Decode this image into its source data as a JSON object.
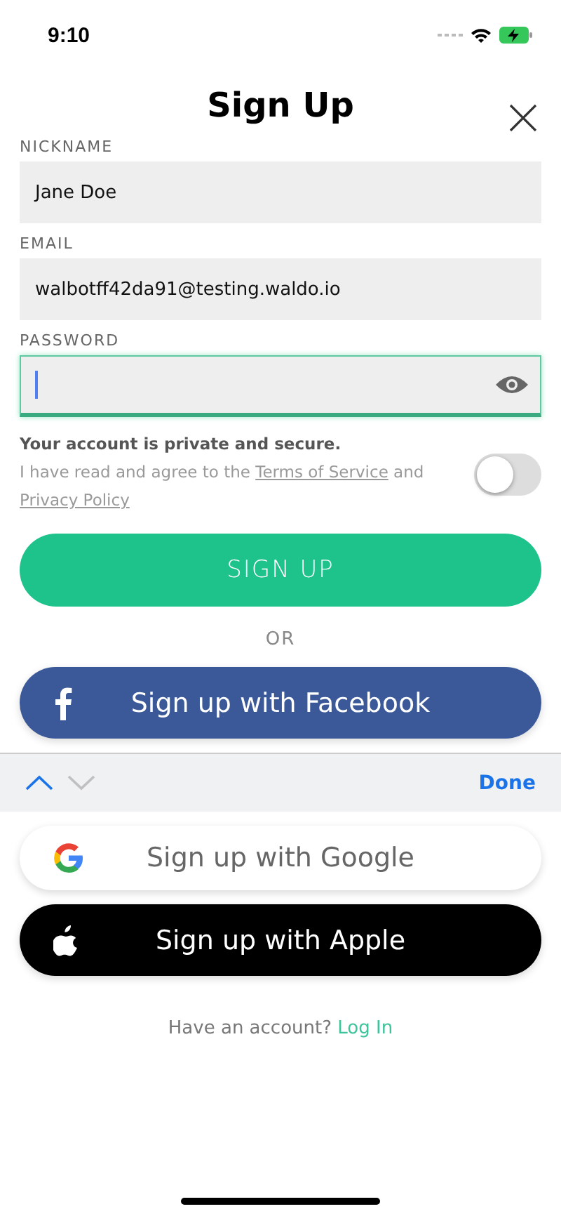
{
  "status_bar": {
    "time": "9:10"
  },
  "title": "Sign Up",
  "fields": [
    {
      "label": "NICKNAME",
      "value": "Jane Doe",
      "focused": false,
      "kind": "text"
    },
    {
      "label": "EMAIL",
      "value": "walbotff42da91@testing.waldo.io",
      "focused": false,
      "kind": "text"
    },
    {
      "label": "PASSWORD",
      "focused": true,
      "kind": "password"
    }
  ],
  "privacy": {
    "heading": "Your account is private and secure.",
    "agree_prefix": "I have read and agree to the",
    "terms_link": "Terms of Service",
    "and": "and",
    "privacy_link": "Privacy Policy",
    "checked": false
  },
  "sign_up_button": "SIGN UP",
  "divider": "OR",
  "social_buttons": [
    {
      "kind": "facebook",
      "label": "Sign up with Facebook"
    },
    {
      "kind": "google",
      "label": "Sign up with Google"
    },
    {
      "kind": "apple",
      "label": "Sign up with Apple"
    }
  ],
  "keyboard_toolbar": {
    "done": "Done"
  },
  "footer": {
    "prompt": "Have an account?",
    "link": "Log In"
  }
}
